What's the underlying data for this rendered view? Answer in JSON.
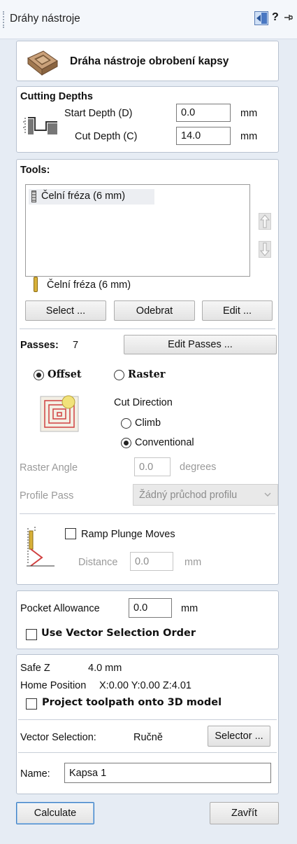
{
  "window": {
    "title": "Dráhy nástroje",
    "help_label": "?",
    "pin_icon": "pin-icon",
    "dock_icon": "dock-panel-icon"
  },
  "header": {
    "heading": "Dráha nástroje obrobení kapsy",
    "icon": "pocket-toolpath-icon"
  },
  "cutting_depths": {
    "title": "Cutting Depths",
    "start_label": "Start Depth (D)",
    "start_value": "0.0",
    "start_unit": "mm",
    "cut_label": "Cut Depth (C)",
    "cut_value": "14.0",
    "cut_unit": "mm"
  },
  "tools": {
    "title": "Tools:",
    "list": [
      "Čelní fréza (6 mm)"
    ],
    "selected_tool": "Čelní fréza (6 mm)",
    "select_label": "Select ...",
    "remove_label": "Odebrat",
    "edit_label": "Edit ..."
  },
  "passes": {
    "label": "Passes:",
    "count": "7",
    "edit_label": "Edit Passes ..."
  },
  "strategy": {
    "offset_label": "Offset",
    "raster_label": "Raster",
    "selected": "Offset",
    "cut_direction_label": "Cut Direction",
    "climb_label": "Climb",
    "conventional_label": "Conventional",
    "direction_selected": "Conventional",
    "raster_angle_label": "Raster Angle",
    "raster_angle_value": "0.0",
    "raster_angle_unit": "degrees",
    "profile_pass_label": "Profile Pass",
    "profile_pass_value": "Žádný průchod profilu"
  },
  "ramp": {
    "label": "Ramp Plunge Moves",
    "checked": false,
    "distance_label": "Distance",
    "distance_value": "0.0",
    "distance_unit": "mm"
  },
  "allowance": {
    "label": "Pocket Allowance",
    "value": "0.0",
    "unit": "mm",
    "vector_order_label": "Use Vector Selection Order",
    "vector_order_checked": false
  },
  "info": {
    "safe_z_label": "Safe Z",
    "safe_z_value": "4.0 mm",
    "home_label": "Home Position",
    "home_value": "X:0.00 Y:0.00 Z:4.01",
    "project_label": "Project toolpath onto 3D model",
    "project_checked": false,
    "vector_sel_label": "Vector Selection:",
    "vector_sel_value": "Ručně",
    "selector_label": "Selector ...",
    "name_label": "Name:",
    "name_value": "Kapsa 1"
  },
  "footer": {
    "calculate_label": "Calculate",
    "close_label": "Zavřít"
  }
}
